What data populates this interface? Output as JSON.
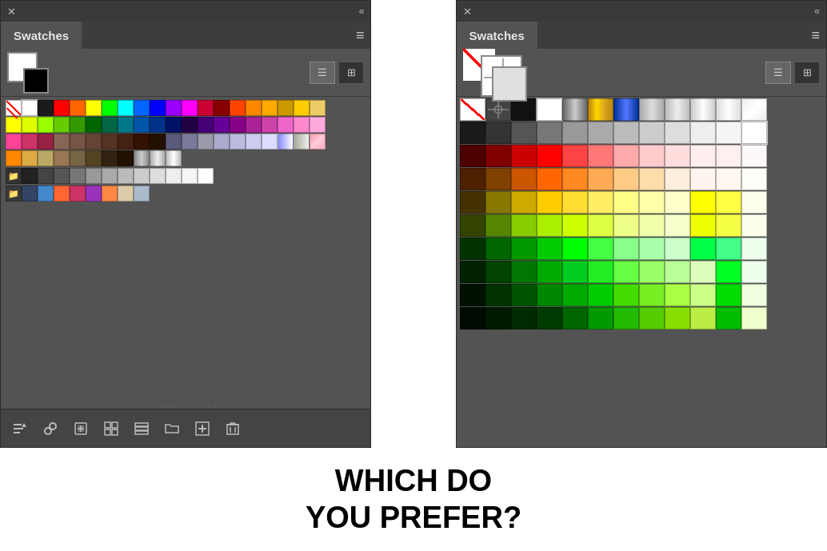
{
  "left_panel": {
    "title": "Swatches",
    "menu_icon": "≡",
    "close_icon": "✕",
    "collapse_icon": "«",
    "view_list_icon": "☰",
    "view_grid_icon": "⊞",
    "toolbar_items": [
      "sort-icon",
      "link-icon",
      "import-icon",
      "grid-icon",
      "list-icon",
      "folder-icon",
      "add-icon",
      "delete-icon"
    ]
  },
  "right_panel": {
    "title": "Swatches",
    "menu_icon": "≡",
    "close_icon": "✕",
    "collapse_icon": "«",
    "view_list_icon": "☰",
    "view_grid_icon": "⊞"
  },
  "bottom_text": {
    "line1": "WHICH DO",
    "line2": "YOU PREFER?"
  },
  "small_swatches": {
    "rows": [
      [
        "#ffffff",
        "#000000",
        "#888888",
        "#ff0000",
        "#00ff00",
        "#00ffff",
        "#0000ff",
        "#ff00ff",
        "#ff0000",
        "#cc0000",
        "#aa0000",
        "#880000",
        "#ff6600",
        "#ffaa00",
        "#ffcc00"
      ],
      [
        "#ffff00",
        "#ccff00",
        "#88ff00",
        "#44aa00",
        "#006600",
        "#009988",
        "#006688",
        "#004499",
        "#002277",
        "#001155",
        "#221166",
        "#441188",
        "#661199",
        "#882299",
        "#aa33aa"
      ],
      [
        "#ff4477",
        "#cc3355",
        "#993344",
        "#886655",
        "#775544",
        "#664433",
        "#553322",
        "#442211",
        "#8888aa",
        "#9999bb",
        "#aaaacc",
        "#bbbbdd",
        "#ccccee",
        "#ddddff",
        "#eeeeff"
      ],
      [
        "#ff8800",
        "#ddaa00",
        "#bb8800",
        "#998866",
        "#776644",
        "#554422",
        "#332211",
        "#221100",
        "#aaaaaa",
        "#bbbbbb",
        "#cccccc",
        "#dddddd",
        "#eeeeee",
        "#f5f5f5",
        "#ffffff"
      ],
      [
        "#222222",
        "#333333",
        "#444444",
        "#555555",
        "#666666",
        "#777777",
        "#888888",
        "#999999",
        "#aaaaaa",
        "#bbbbbb",
        "#cccccc",
        "#dddddd",
        "#eeeeee"
      ],
      [
        "#223344",
        "#336699",
        "#66aacc",
        "#88cc00",
        "#ff6633",
        "#cc3366",
        "#993399",
        "#6600cc"
      ]
    ]
  },
  "large_swatches_rows": []
}
